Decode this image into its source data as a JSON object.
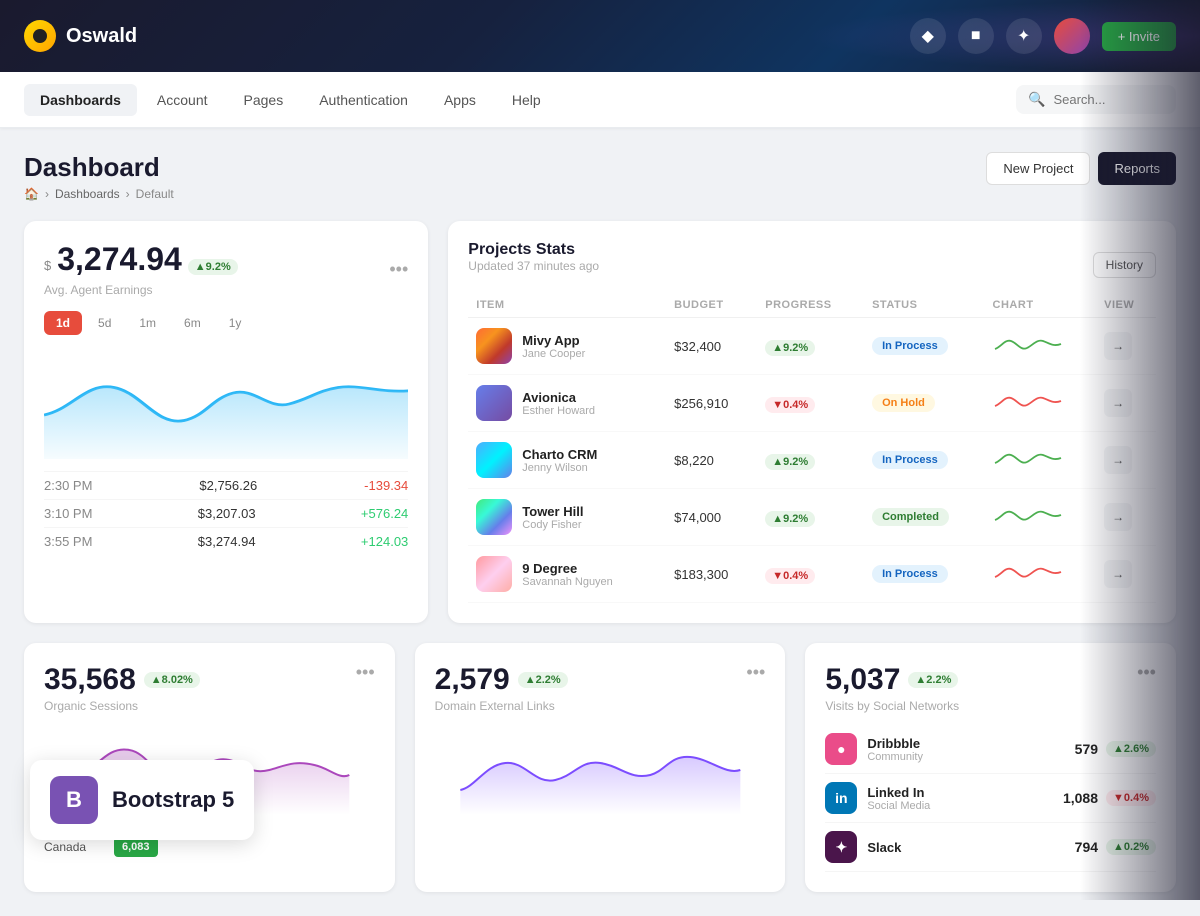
{
  "app": {
    "logo_text": "Oswald",
    "invite_label": "+ Invite"
  },
  "nav": {
    "items": [
      {
        "id": "dashboards",
        "label": "Dashboards",
        "active": true
      },
      {
        "id": "account",
        "label": "Account",
        "active": false
      },
      {
        "id": "pages",
        "label": "Pages",
        "active": false
      },
      {
        "id": "authentication",
        "label": "Authentication",
        "active": false
      },
      {
        "id": "apps",
        "label": "Apps",
        "active": false
      },
      {
        "id": "help",
        "label": "Help",
        "active": false
      }
    ],
    "search_placeholder": "Search..."
  },
  "page": {
    "title": "Dashboard",
    "breadcrumb": [
      "home",
      "Dashboards",
      "Default"
    ],
    "btn_new_project": "New Project",
    "btn_reports": "Reports"
  },
  "earnings": {
    "currency_symbol": "$",
    "value": "3,274.94",
    "badge": "▲9.2%",
    "label": "Avg. Agent Earnings",
    "time_filters": [
      "1d",
      "5d",
      "1m",
      "6m",
      "1y"
    ],
    "active_filter": "1d",
    "rows": [
      {
        "time": "2:30 PM",
        "amount": "$2,756.26",
        "change": "-139.34",
        "positive": false
      },
      {
        "time": "3:10 PM",
        "amount": "$3,207.03",
        "change": "+576.24",
        "positive": true
      },
      {
        "time": "3:55 PM",
        "amount": "$3,274.94",
        "change": "+124.03",
        "positive": true
      }
    ]
  },
  "projects": {
    "title": "Projects Stats",
    "subtitle": "Updated 37 minutes ago",
    "history_btn": "History",
    "columns": [
      "ITEM",
      "BUDGET",
      "PROGRESS",
      "STATUS",
      "CHART",
      "VIEW"
    ],
    "rows": [
      {
        "name": "Mivy App",
        "person": "Jane Cooper",
        "budget": "$32,400",
        "progress": "▲9.2%",
        "progress_up": true,
        "status": "In Process",
        "status_class": "inprocess",
        "color_class": "pi-1"
      },
      {
        "name": "Avionica",
        "person": "Esther Howard",
        "budget": "$256,910",
        "progress": "▼0.4%",
        "progress_up": false,
        "status": "On Hold",
        "status_class": "onhold",
        "color_class": "pi-2"
      },
      {
        "name": "Charto CRM",
        "person": "Jenny Wilson",
        "budget": "$8,220",
        "progress": "▲9.2%",
        "progress_up": true,
        "status": "In Process",
        "status_class": "inprocess",
        "color_class": "pi-3"
      },
      {
        "name": "Tower Hill",
        "person": "Cody Fisher",
        "budget": "$74,000",
        "progress": "▲9.2%",
        "progress_up": true,
        "status": "Completed",
        "status_class": "completed",
        "color_class": "pi-4"
      },
      {
        "name": "9 Degree",
        "person": "Savannah Nguyen",
        "budget": "$183,300",
        "progress": "▼0.4%",
        "progress_up": false,
        "status": "In Process",
        "status_class": "inprocess",
        "color_class": "pi-5"
      }
    ]
  },
  "sessions": {
    "value": "35,568",
    "badge": "▲8.02%",
    "label": "Organic Sessions"
  },
  "domain_links": {
    "value": "2,579",
    "badge": "▲2.2%",
    "label": "Domain External Links"
  },
  "social": {
    "value": "5,037",
    "badge": "▲2.2%",
    "label": "Visits by Social Networks",
    "rows": [
      {
        "name": "Dribbble",
        "type": "Community",
        "count": "579",
        "badge": "▲2.6%",
        "positive": true,
        "color": "#ea4c89"
      },
      {
        "name": "Linked In",
        "type": "Social Media",
        "count": "1,088",
        "badge": "▼0.4%",
        "positive": false,
        "color": "#0077b5"
      },
      {
        "name": "Slack",
        "type": "",
        "count": "794",
        "badge": "▲0.2%",
        "positive": true,
        "color": "#4a154b"
      }
    ]
  },
  "geo": {
    "label": "Canada",
    "value": "6,083"
  },
  "bootstrap": {
    "label": "Bootstrap 5"
  }
}
